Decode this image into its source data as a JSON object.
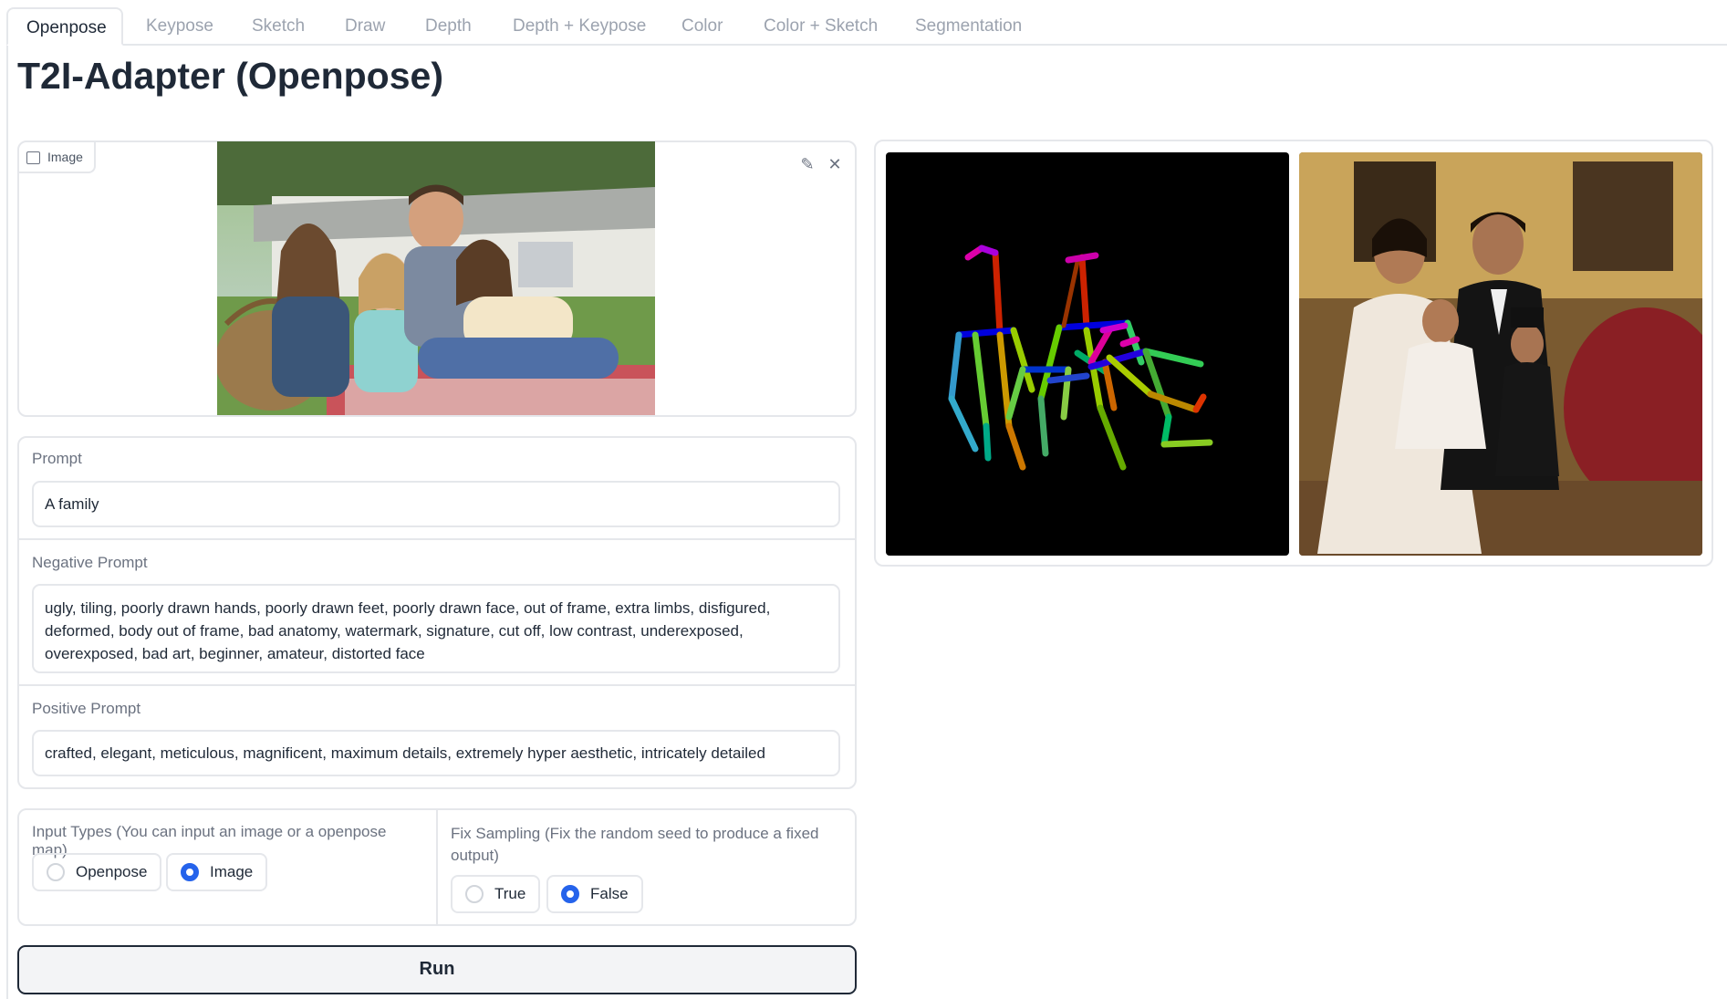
{
  "tabs": [
    {
      "label": "Openpose",
      "active": true
    },
    {
      "label": "Keypose",
      "active": false
    },
    {
      "label": "Sketch",
      "active": false
    },
    {
      "label": "Draw",
      "active": false
    },
    {
      "label": "Depth",
      "active": false
    },
    {
      "label": "Depth + Keypose",
      "active": false
    },
    {
      "label": "Color",
      "active": false
    },
    {
      "label": "Color + Sketch",
      "active": false
    },
    {
      "label": "Segmentation",
      "active": false
    }
  ],
  "page": {
    "title": "T2I-Adapter (Openpose)"
  },
  "image_input": {
    "badge_label": "Image",
    "edit_icon": "pencil-icon",
    "clear_icon": "close-icon"
  },
  "prompt": {
    "label": "Prompt",
    "value": "A family"
  },
  "negative_prompt": {
    "label": "Negative Prompt",
    "value": "ugly, tiling, poorly drawn hands, poorly drawn feet, poorly drawn face, out of frame, extra limbs, disfigured, deformed, body out of frame, bad anatomy, watermark, signature, cut off, low contrast, underexposed, overexposed, bad art, beginner, amateur, distorted face"
  },
  "positive_prompt": {
    "label": "Positive Prompt",
    "value": "crafted, elegant, meticulous, magnificent, maximum details, extremely hyper aesthetic, intricately detailed"
  },
  "input_types": {
    "label": "Input Types (You can input an image or a openpose map)",
    "options": [
      {
        "label": "Openpose",
        "selected": false
      },
      {
        "label": "Image",
        "selected": true
      }
    ]
  },
  "fix_sampling": {
    "label": "Fix Sampling (Fix the random seed to produce a fixed output)",
    "options": [
      {
        "label": "True",
        "selected": false
      },
      {
        "label": "False",
        "selected": true
      }
    ]
  },
  "run_button": {
    "label": "Run"
  },
  "colors": {
    "accent": "#2563eb",
    "border": "#e5e7eb",
    "text": "#1f2937",
    "muted": "#9ca3af"
  }
}
